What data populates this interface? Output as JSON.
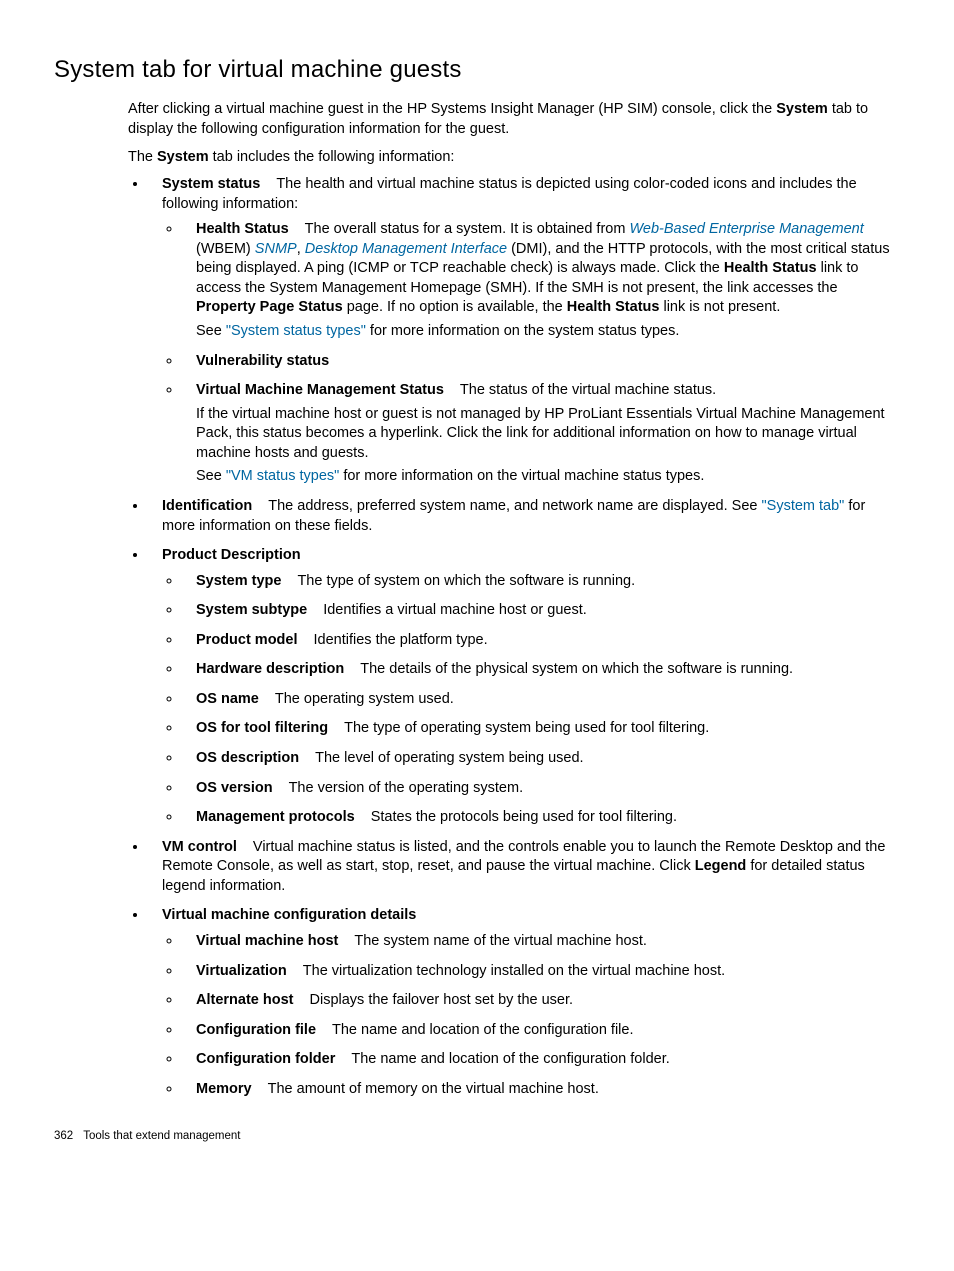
{
  "heading": "System tab for virtual machine guests",
  "intro1a": "After clicking a virtual machine guest in the HP Systems Insight Manager (HP SIM) console, click the ",
  "intro1b": "System",
  "intro1c": " tab to display the following configuration information for the guest.",
  "intro2a": "The ",
  "intro2b": "System",
  "intro2c": " tab includes the following information:",
  "ss": {
    "term": "System status",
    "desc": "The health and virtual machine status is depicted using color-coded icons and includes the following information:",
    "hs": {
      "term": "Health Status",
      "t1": "The overall status for a system. It is obtained from ",
      "wbem": "Web-Based Enterprise Management",
      "t2": " (WBEM) ",
      "snmp": "SNMP",
      "t3": ", ",
      "dmi": "Desktop Management Interface",
      "t4": " (DMI), and the HTTP protocols, with the most critical status being displayed. A ping (ICMP or TCP reachable check) is always made. Click the ",
      "b1": "Health Status",
      "t5": " link to access the System Management Homepage (SMH). If the SMH is not present, the link accesses the ",
      "b2": "Property Page Status",
      "t6": " page. If no option is available, the ",
      "b3": "Health Status",
      "t7": " link is not present.",
      "see1": "See ",
      "link1": "\"System status types\"",
      "see2": " for more information on the system status types."
    },
    "vuln": {
      "term": "Vulnerability status"
    },
    "vmms": {
      "term": "Virtual Machine Management Status",
      "desc": "The status of the virtual machine status.",
      "p": "If the virtual machine host or guest is not managed by HP ProLiant Essentials Virtual Machine Management Pack, this status becomes a hyperlink. Click the link for additional information on how to manage virtual machine hosts and guests.",
      "see1": "See ",
      "link1": "\"VM status types\"",
      "see2": " for more information on the virtual machine status types."
    }
  },
  "ident": {
    "term": "Identification",
    "t1": "The address, preferred system name, and network name are displayed. See ",
    "link": "\"System tab\"",
    "t2": " for more information on these fields."
  },
  "pd": {
    "term": "Product Description",
    "items": [
      {
        "term": "System type",
        "desc": "The type of system on which the software is running."
      },
      {
        "term": "System subtype",
        "desc": "Identifies a virtual machine host or guest."
      },
      {
        "term": "Product model",
        "desc": "Identifies the platform type."
      },
      {
        "term": "Hardware description",
        "desc": "The details of the physical system on which the software is running."
      },
      {
        "term": "OS name",
        "desc": "The operating system used."
      },
      {
        "term": "OS for tool filtering",
        "desc": "The type of operating system being used for tool filtering."
      },
      {
        "term": "OS description",
        "desc": "The level of operating system being used."
      },
      {
        "term": "OS version",
        "desc": "The version of the operating system."
      },
      {
        "term": "Management protocols",
        "desc": "States the protocols being used for tool filtering."
      }
    ]
  },
  "vmc": {
    "term": "VM control",
    "t1": "Virtual machine status is listed, and the controls enable you to launch the Remote Desktop and the Remote Console, as well as start, stop, reset, and pause the virtual machine. Click ",
    "b1": "Legend",
    "t2": " for detailed status legend information."
  },
  "vmcd": {
    "term": "Virtual machine configuration details",
    "items": [
      {
        "term": "Virtual machine host",
        "desc": "The system name of the virtual machine host."
      },
      {
        "term": "Virtualization",
        "desc": "The virtualization technology installed on the virtual machine host."
      },
      {
        "term": "Alternate host",
        "desc": "Displays the failover host set by the user."
      },
      {
        "term": "Configuration file",
        "desc": "The name and location of the configuration file."
      },
      {
        "term": "Configuration folder",
        "desc": "The name and location of the configuration folder."
      },
      {
        "term": "Memory",
        "desc": "The amount of memory on the virtual machine host."
      }
    ]
  },
  "footer": {
    "page": "362",
    "title": "Tools that extend management"
  }
}
